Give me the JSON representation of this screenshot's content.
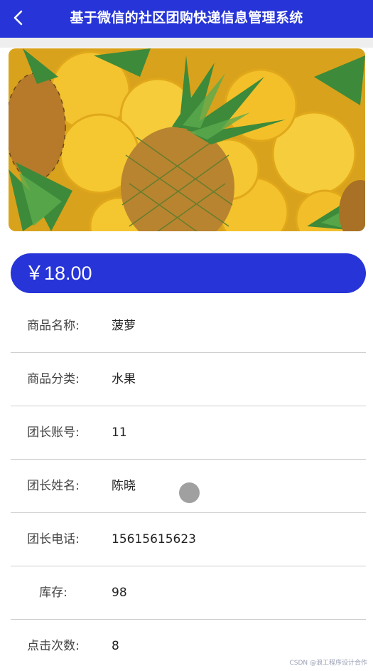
{
  "header": {
    "title": "基于微信的社区团购快递信息管理系统",
    "back_icon": "chevron-left-icon"
  },
  "product": {
    "image_alt": "pineapple",
    "price": "￥18.00"
  },
  "info_rows": [
    {
      "label": "商品名称:",
      "value": "菠萝"
    },
    {
      "label": "商品分类:",
      "value": "水果"
    },
    {
      "label": "团长账号:",
      "value": "11"
    },
    {
      "label": "团长姓名:",
      "value": "陈晓"
    },
    {
      "label": "团长电话:",
      "value": "15615615623"
    },
    {
      "label": "库存:",
      "value": "98"
    },
    {
      "label": "点击次数:",
      "value": "8"
    }
  ],
  "watermark": "CSDN @浪工程序设计合作",
  "colors": {
    "primary": "#2634d8",
    "divider": "#cfcfcf"
  }
}
